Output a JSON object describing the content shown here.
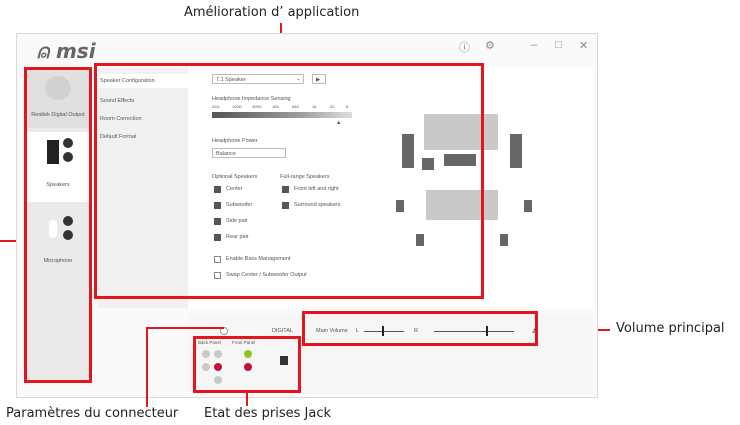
{
  "callouts": {
    "app_enhancement": "Amélioration d’ application",
    "main_volume": "Volume principal",
    "connector_settings": "Paramètres du connecteur",
    "jack_status": "Etat des prises Jack"
  },
  "app": {
    "logo": "msi",
    "window_controls": {
      "info": "ⓘ",
      "settings": "⚙",
      "minimize": "–",
      "maximize": "□",
      "close": "✕"
    },
    "sidebar": {
      "devices": [
        {
          "label": "Realtek Digital Output"
        },
        {
          "label": "Speakers"
        },
        {
          "label": "Microphone"
        }
      ]
    },
    "tabs": [
      "Speaker Configuration",
      "Sound Effects",
      "Room Correction",
      "Default Format"
    ],
    "speaker_config": {
      "config_value": "7.1 Speaker",
      "play_button": "▶",
      "impedance_label": "Headphone Impedance Sensing",
      "impedance_ticks": [
        "32Ω",
        "100Ω",
        "300Ω",
        "16K",
        "64K",
        "16",
        "32",
        "8"
      ],
      "headphone_power_label": "Headphone Power",
      "headphone_power_value": "Balance",
      "optional_speakers_label": "Optional Speakers",
      "optional_speakers": [
        "Center",
        "Subwoofer",
        "Side pair",
        "Rear pair"
      ],
      "fullrange_label": "Full-range Speakers",
      "fullrange_speakers": [
        "Front left and right",
        "Surround speakers"
      ],
      "bass_management": "Enable Bass Management",
      "swap_center": "Swap Center / Subwoofer Output"
    },
    "bottom": {
      "digital_label": "DIGITAL",
      "main_volume_label": "Main Volume",
      "volume_l": "L",
      "volume_r": "R",
      "back_panel": "Back Panel",
      "front_panel": "Front Panel"
    },
    "colors": {
      "accent_red": "#e2161c",
      "jack_green": "#8fc31f",
      "jack_pink": "#c0143c"
    }
  }
}
